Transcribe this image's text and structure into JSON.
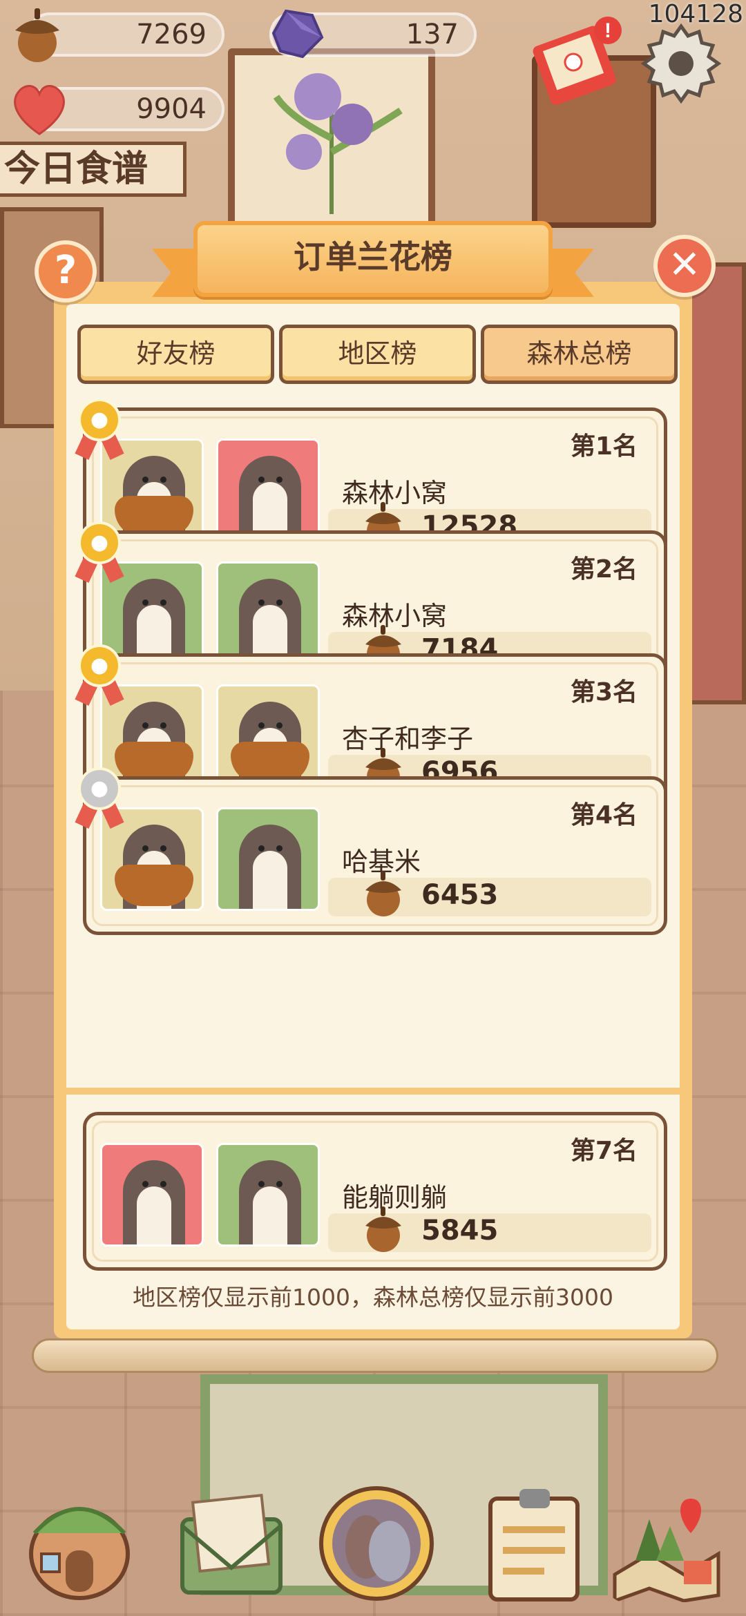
{
  "hud": {
    "acorns": "7269",
    "gems": "137",
    "hearts": "9904",
    "player_id": "104128"
  },
  "background": {
    "sign_text": "今日食谱"
  },
  "dialog": {
    "title": "订单兰花榜",
    "help_symbol": "?",
    "close_symbol": "✕",
    "tabs": [
      {
        "label": "好友榜",
        "active": false
      },
      {
        "label": "地区榜",
        "active": false
      },
      {
        "label": "森林总榜",
        "active": true
      }
    ],
    "rankings": [
      {
        "rank": "第1名",
        "name": "森林小窝",
        "score": "12528",
        "medal": "gold",
        "avatars": [
          "floral",
          "pink"
        ]
      },
      {
        "rank": "第2名",
        "name": "森林小窝",
        "score": "7184",
        "medal": "gold",
        "avatars": [
          "green",
          "green"
        ]
      },
      {
        "rank": "第3名",
        "name": "杏子和李子",
        "score": "6956",
        "medal": "gold",
        "avatars": [
          "floral",
          "floral"
        ]
      },
      {
        "rank": "第4名",
        "name": "哈基米",
        "score": "6453",
        "medal": "silver",
        "avatars": [
          "floral",
          "green"
        ]
      }
    ],
    "self_entry": {
      "rank": "第7名",
      "name": "能躺则躺",
      "score": "5845",
      "avatars": [
        "pink",
        "green"
      ]
    },
    "footer_note": "地区榜仅显示前1000，森林总榜仅显示前3000"
  },
  "colors": {
    "panel_orange": "#f7c77a",
    "card_border": "#7a5238",
    "gold_medal": "#f5b92e",
    "silver_medal": "#c9c9c9"
  },
  "icons": [
    "acorn-icon",
    "gem-icon",
    "heart-icon",
    "envelope-icon",
    "gear-icon",
    "help-icon",
    "close-icon",
    "paw-medal-icon",
    "house-icon",
    "mail-icon",
    "otter-button-icon",
    "clipboard-icon",
    "map-icon"
  ]
}
